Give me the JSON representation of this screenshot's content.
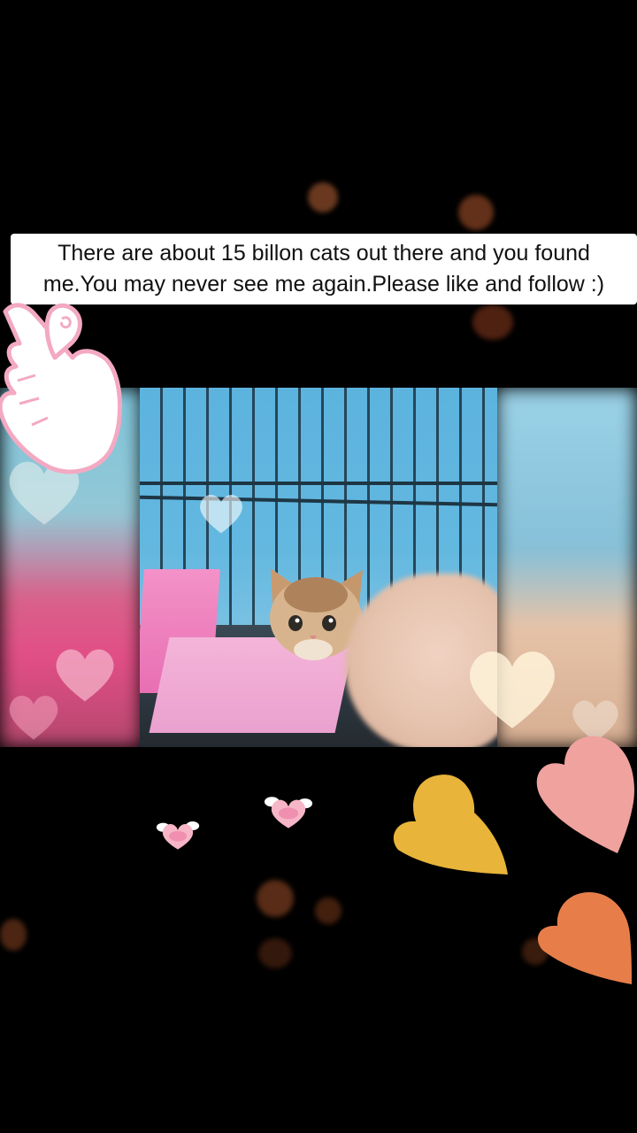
{
  "caption": {
    "line1": "There are about 15 billon cats out there and you found",
    "line2": "me.You may never see me again.Please like and follow :)"
  },
  "colors": {
    "background": "#000000",
    "caption_bg": "#ffffff",
    "heart_yellow": "#e8b43a",
    "heart_pink": "#f0a29e",
    "heart_orange": "#e77e4a",
    "tiny_heart": "#f7b5c8"
  },
  "decorations": {
    "hand_sign_icon": "finger-heart-icon",
    "winged_hearts": [
      "winged-heart-icon",
      "winged-heart-icon"
    ],
    "hearts": [
      "heart-yellow-icon",
      "heart-pink-icon",
      "heart-orange-icon"
    ]
  }
}
